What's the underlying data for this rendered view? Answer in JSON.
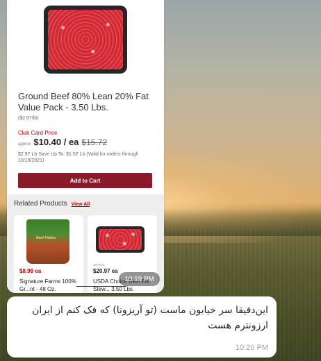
{
  "screenshot": {
    "product": {
      "title": "Ground Beef 80% Lean 20% Fat Value Pack - 3.50 Lbs.",
      "unit_price": "($2.97/lb)",
      "club_label": "Club Card Price",
      "approx": "approx",
      "price": "$10.40 / ea",
      "was_price": "$15.72",
      "save_text": "$2.97 Lb Save Up To: $1.52 Lb (Valid for orders through 10/19/2021)",
      "add_to_cart": "Add to Cart"
    },
    "related": {
      "heading": "Related Products",
      "view_all": "View All",
      "items": [
        {
          "price": "$8.99 ea",
          "name": "Signature Farms 100% Gr...nt - 48 Oz.",
          "bag_label": "Beef Patties"
        },
        {
          "approx": "APPROX",
          "price": "$20.97 ea",
          "name": "USDA Choice Beef For Stew... 3.50 Lbs."
        }
      ]
    },
    "time": "10:19 PM"
  },
  "message": {
    "text": "این‌دقیقا سر خیابون ماست (تو آریزونا) که فک کنم از ایران ارزونترم هست",
    "time": "10:20 PM"
  },
  "colors": {
    "brand_red": "#8b1a2b",
    "club_red": "#c00000"
  }
}
